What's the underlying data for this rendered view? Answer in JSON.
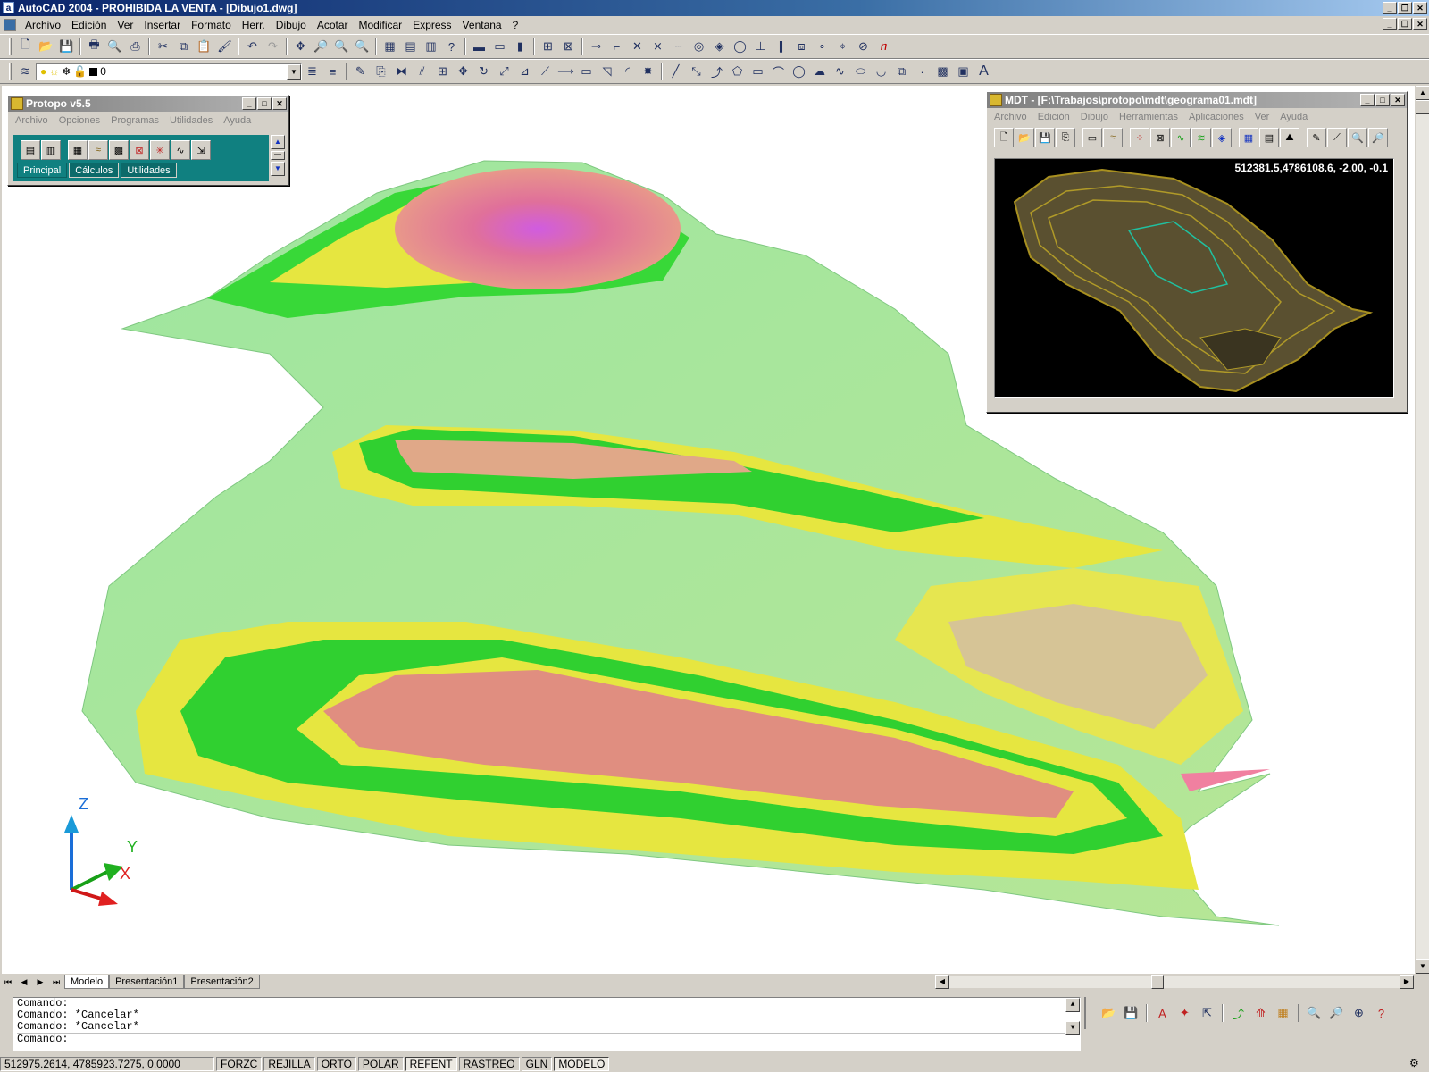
{
  "window": {
    "title": "AutoCAD 2004 - PROHIBIDA LA VENTA - [Dibujo1.dwg]",
    "app_icon": "a"
  },
  "menu": [
    "Archivo",
    "Edición",
    "Ver",
    "Insertar",
    "Formato",
    "Herr.",
    "Dibujo",
    "Acotar",
    "Modificar",
    "Express",
    "Ventana",
    "?"
  ],
  "layer": {
    "name": "0"
  },
  "protopo": {
    "title": "Protopo v5.5",
    "menu": [
      "Archivo",
      "Opciones",
      "Programas",
      "Utilidades",
      "Ayuda"
    ],
    "tabs": [
      "Principal",
      "Cálculos",
      "Utilidades"
    ]
  },
  "mdt": {
    "title": "MDT - [F:\\Trabajos\\protopo\\mdt\\geograma01.mdt]",
    "menu": [
      "Archivo",
      "Edición",
      "Dibujo",
      "Herramientas",
      "Aplicaciones",
      "Ver",
      "Ayuda"
    ],
    "coords": "512381.5,4786108.6,  -2.00,  -0.1"
  },
  "ucs": {
    "x": "X",
    "y": "Y",
    "z": "Z"
  },
  "layout_tabs": [
    "Modelo",
    "Presentación1",
    "Presentación2"
  ],
  "command_lines": [
    "Comando:",
    "Comando: *Cancelar*",
    "Comando: *Cancelar*",
    "Comando:"
  ],
  "status": {
    "coords": "512975.2614, 4785923.7275, 0.0000",
    "buttons": [
      "FORZC",
      "REJILLA",
      "ORTO",
      "POLAR",
      "REFENT",
      "RASTREO",
      "GLN",
      "MODELO"
    ]
  }
}
